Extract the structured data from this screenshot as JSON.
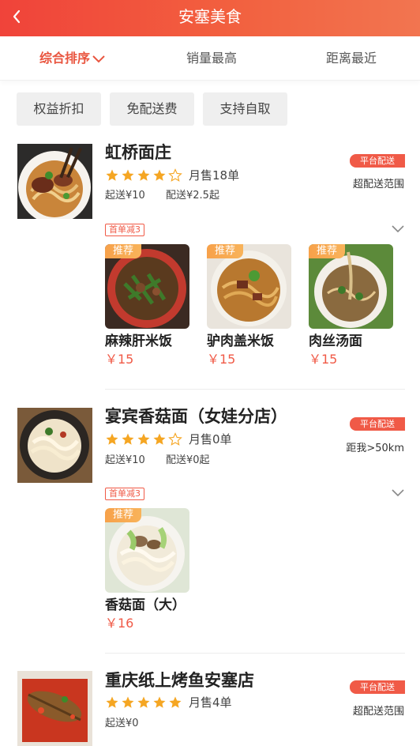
{
  "header": {
    "title": "安塞美食"
  },
  "sort": {
    "items": [
      "综合排序",
      "销量最高",
      "距离最近"
    ]
  },
  "filters": [
    "权益折扣",
    "免配送费",
    "支持自取"
  ],
  "shops": [
    {
      "name": "虹桥面庄",
      "rating": 4,
      "sales": "月售18单",
      "min_order": "起送¥10",
      "delivery_fee": "配送¥2.5起",
      "badge": "平台配送",
      "note": "超配送范围",
      "promo": "首单减3",
      "dishes": [
        {
          "tag": "推荐",
          "name": "麻辣肝米饭",
          "price": "￥15"
        },
        {
          "tag": "推荐",
          "name": "驴肉盖米饭",
          "price": "￥15"
        },
        {
          "tag": "推荐",
          "name": "肉丝汤面",
          "price": "￥15"
        }
      ]
    },
    {
      "name": "宴宾香菇面（女娃分店）",
      "rating": 4,
      "sales": "月售0单",
      "min_order": "起送¥10",
      "delivery_fee": "配送¥0起",
      "badge": "平台配送",
      "note": "距我>50km",
      "promo": "首单减3",
      "dishes": [
        {
          "tag": "推荐",
          "name": "香菇面（大）",
          "price": "￥16"
        }
      ]
    },
    {
      "name": "重庆纸上烤鱼安塞店",
      "rating": 5,
      "sales": "月售4单",
      "min_order": "起送¥0",
      "badge": "平台配送",
      "note": "超配送范围"
    }
  ],
  "colors": {
    "accent": "#f05a47",
    "star": "#f5a623",
    "star_empty": "#cccccc"
  },
  "icons": {
    "back": "chevron-left-icon",
    "sort": "chevron-down-icon",
    "expand": "chevron-down-icon",
    "star": "star-icon"
  }
}
